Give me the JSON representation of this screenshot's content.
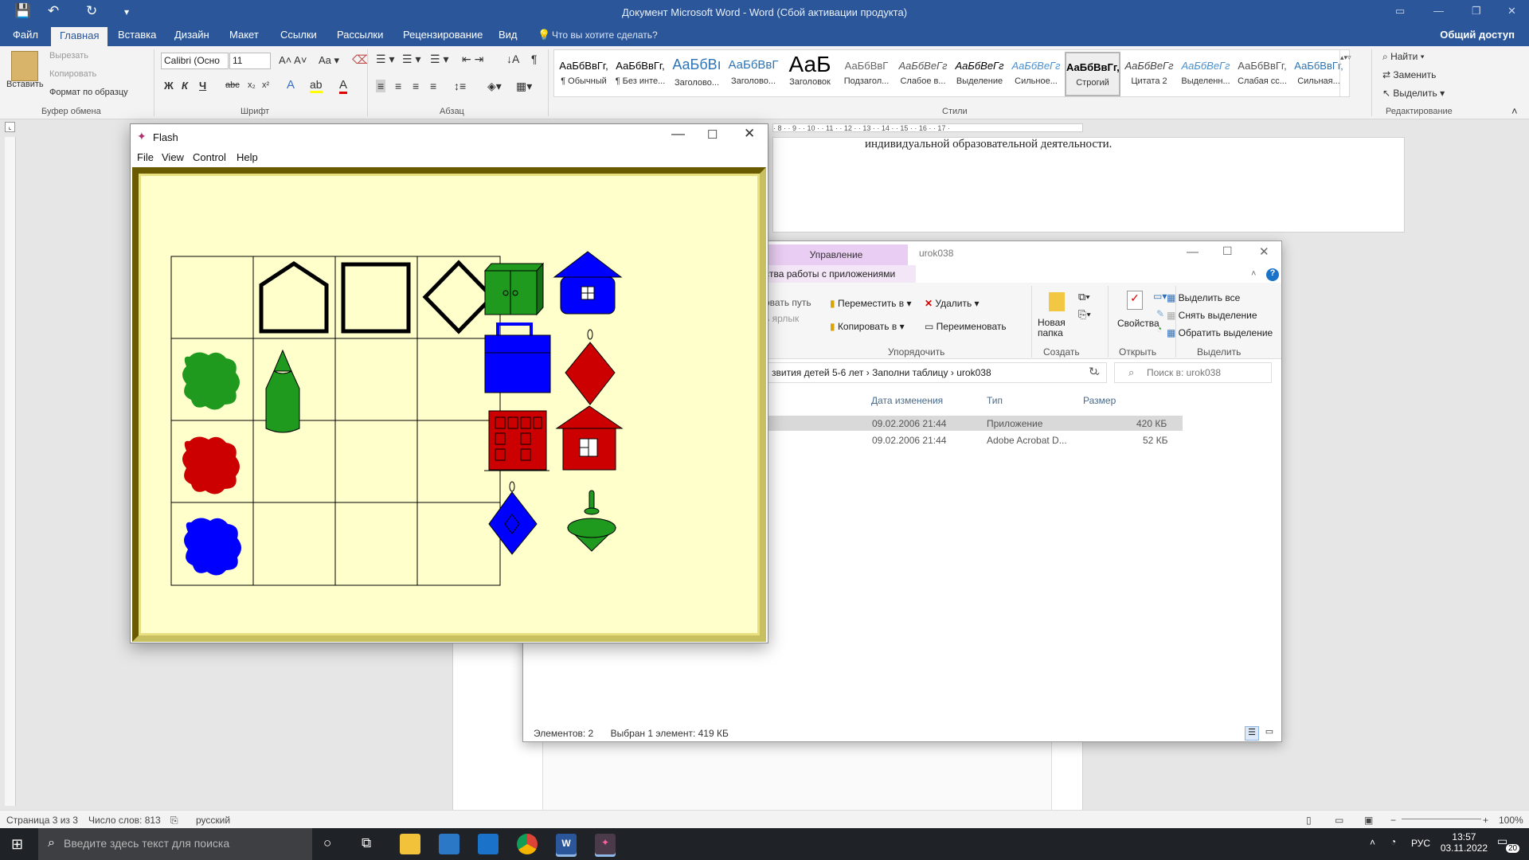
{
  "word": {
    "title": "Документ Microsoft Word - Word (Сбой активации продукта)",
    "tabs": [
      "Файл",
      "Главная",
      "Вставка",
      "Дизайн",
      "Макет",
      "Ссылки",
      "Рассылки",
      "Рецензирование",
      "Вид"
    ],
    "tell_me": "Что вы хотите сделать?",
    "share": "Общий доступ",
    "clipboard": {
      "paste": "Вставить",
      "cut": "Вырезать",
      "copy": "Копировать",
      "format_painter": "Формат по образцу",
      "label": "Буфер обмена"
    },
    "font": {
      "name": "Calibri (Осно",
      "size": "11",
      "label": "Шрифт"
    },
    "paragraph_label": "Абзац",
    "styles": [
      {
        "preview": "АаБбВвГг,",
        "name": "¶ Обычный"
      },
      {
        "preview": "АаБбВвГг,",
        "name": "¶ Без инте..."
      },
      {
        "preview": "АаБбВı",
        "name": "Заголово..."
      },
      {
        "preview": "АаБбВвГ",
        "name": "Заголово..."
      },
      {
        "preview": "АаБ",
        "name": "Заголовок"
      },
      {
        "preview": "АаБбВвГ",
        "name": "Подзагол..."
      },
      {
        "preview": "АаБбВеГг",
        "name": "Слабое в..."
      },
      {
        "preview": "АаБбВеГг",
        "name": "Выделение"
      },
      {
        "preview": "АаБбВеГг",
        "name": "Сильное..."
      },
      {
        "preview": "АаБбВвГг,",
        "name": "Строгий"
      },
      {
        "preview": "АаБбВеГг",
        "name": "Цитата 2"
      },
      {
        "preview": "АаБбВеГг",
        "name": "Выделенн..."
      },
      {
        "preview": "АаБбВвГг,",
        "name": "Слабая сс..."
      },
      {
        "preview": "АаБбВвГг,",
        "name": "Сильная..."
      }
    ],
    "styles_label": "Стили",
    "editing": {
      "find": "Найти",
      "replace": "Заменить",
      "select": "Выделить",
      "label": "Редактирование"
    },
    "ruler_numbers": "· 8 · · 9 · · 10 · · 11 · · 12 · · 13 · · 14 · · 15 · · 16 · · 17 ·",
    "doc_text": "индивидуальной образовательной деятельности.",
    "status": {
      "page": "Страница 3 из 3",
      "words": "Число слов: 813",
      "lang": "русский",
      "zoom": "100%"
    }
  },
  "explorer": {
    "manage_tab": "Управление",
    "folder": "urok038",
    "ribbon_sub": "ства работы с приложениями",
    "path_partial": [
      "овать путь",
      "ь ярлык"
    ],
    "organize": {
      "move": "Переместить в",
      "copy": "Копировать в",
      "delete": "Удалить",
      "rename": "Переименовать",
      "label": "Упорядочить"
    },
    "create": {
      "new_folder": "Новая папка",
      "label": "Создать"
    },
    "open": {
      "properties": "Свойства",
      "label": "Открыть"
    },
    "select": {
      "all": "Выделить все",
      "none": "Снять выделение",
      "invert": "Обратить выделение",
      "label": "Выделить"
    },
    "breadcrumb": [
      "звития детей 5-6 лет",
      "Заполни таблицу",
      "urok038"
    ],
    "search_placeholder": "Поиск в: urok038",
    "columns": [
      "Дата изменения",
      "Тип",
      "Размер"
    ],
    "rows": [
      {
        "date": "09.02.2006 21:44",
        "type": "Приложение",
        "size": "420 КБ"
      },
      {
        "date": "09.02.2006 21:44",
        "type": "Adobe Acrobat D...",
        "size": "52 КБ"
      }
    ],
    "status_count": "Элементов: 2",
    "status_selected": "Выбран 1 элемент: 419 КБ"
  },
  "flash": {
    "title": "Flash",
    "menu": [
      "File",
      "View",
      "Control",
      "Help"
    ],
    "colors": {
      "green": "#1f9a1f",
      "red": "#cc0000",
      "blue": "#0000ff",
      "stage": "#ffffcc"
    }
  },
  "taskbar": {
    "search_placeholder": "Введите здесь текст для поиска",
    "lang": "РУС",
    "time": "13:57",
    "date": "03.11.2022",
    "notifications": "20"
  }
}
